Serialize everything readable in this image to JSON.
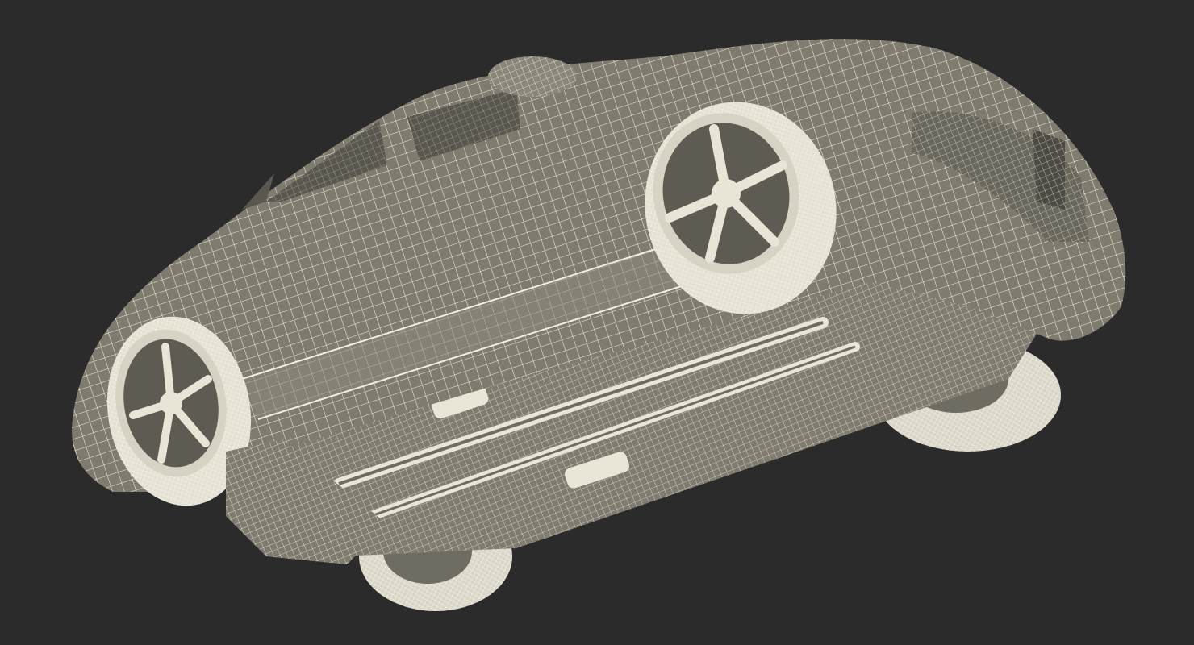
{
  "scene": {
    "background_color": "#2b2b2b",
    "model_color": "#7f7c6f",
    "model_shadow_color": "#5f5d52",
    "wire_color": "#f1efe3",
    "subject": "car-wireframe-render-underside-view"
  }
}
